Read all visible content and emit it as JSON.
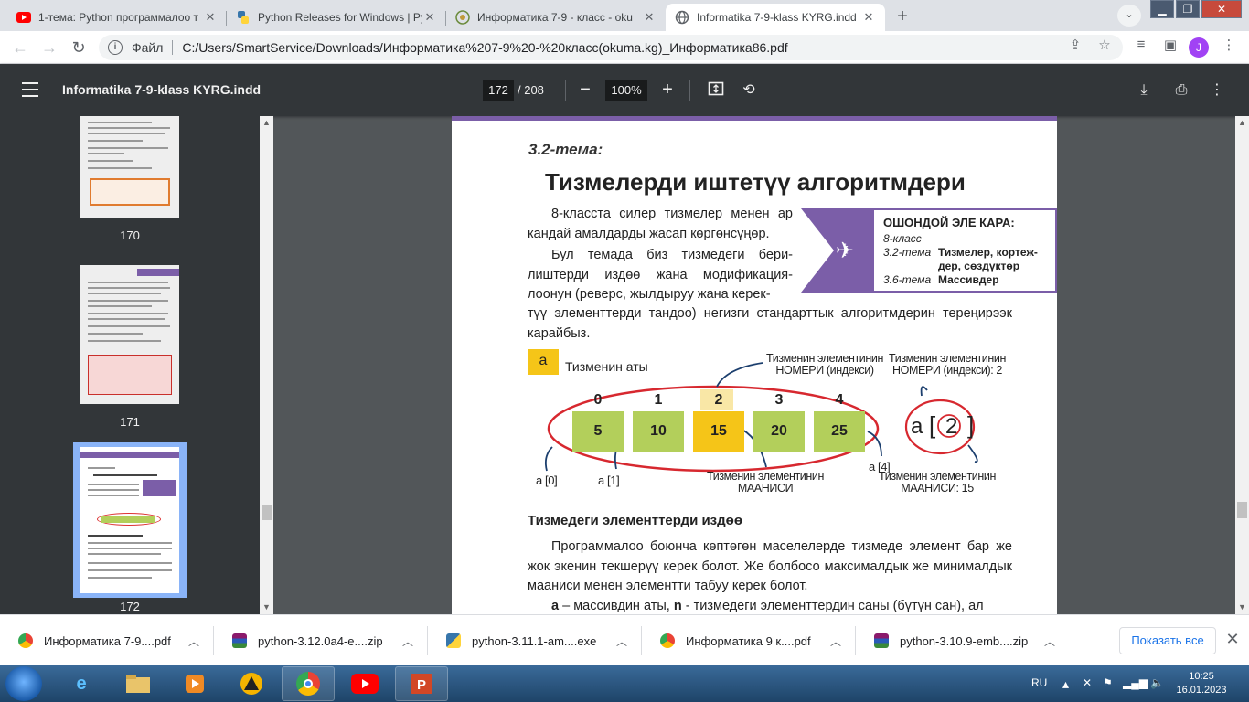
{
  "tabs": [
    {
      "title": "1-тема: Python программалоо т",
      "icon": "youtube-icon",
      "color": "#ff0000"
    },
    {
      "title": "Python Releases for Windows | Py",
      "icon": "python-icon",
      "color": "#3776ab"
    },
    {
      "title": "Информатика 7-9 - класс - oku",
      "icon": "site-icon",
      "color": "#6a8a3a"
    },
    {
      "title": "Informatika 7-9-klass KYRG.indd",
      "icon": "globe-icon",
      "color": "#5f6368"
    }
  ],
  "address": {
    "scheme": "Файл",
    "url": "C:/Users/SmartService/Downloads/Информатика%207-9%20-%20класс(okuma.kg)_Информатика86.pdf"
  },
  "profile_initial": "J",
  "pdf": {
    "title": "Informatika 7-9-klass KYRG.indd",
    "current_page": "172",
    "total_pages": "/ 208",
    "zoom": "100%"
  },
  "thumbnails": [
    {
      "num": "170"
    },
    {
      "num": "171"
    },
    {
      "num": "172"
    }
  ],
  "page": {
    "topic": "3.2-тема:",
    "title": "Тизмелерди иштетүү алгоритмдери",
    "para1": "8-класста силер тизмелер менен ар кандай амалдарды жасап көргөнсүңөр.",
    "para2": "Бул темада биз тизмедеги бериллиштерди издөө жана модификациялоонун (реверс, жылдыруу жана керектүү элементтерди тандоо) негизги стандарттык алгоритмдерин тереңирээк карайбыз.",
    "sidebox": {
      "title": "ОШОНДОЙ ЭЛЕ КАРА:",
      "grade": "8-класс",
      "rows": [
        {
          "topic": "3.2-тема",
          "text": "Тизмелер, кортеж-дер, сөздүктөр"
        },
        {
          "topic": "3.6-тема",
          "text": "Массивдер"
        }
      ]
    },
    "diagram": {
      "name_box": "a",
      "name_label": "Тизменин аты",
      "indices": [
        "0",
        "1",
        "2",
        "3",
        "4"
      ],
      "values": [
        "5",
        "10",
        "15",
        "20",
        "25"
      ],
      "ref_a0": "a [0]",
      "ref_a1": "a [1]",
      "ref_a4": "a [4]",
      "index_label_1": "Тизменин элементинин НОМЕРИ (индекси)",
      "index_label_2": "Тизменин элементинин НОМЕРИ (индекси): 2",
      "value_label_1": "Тизменин элементинин МААНИСИ",
      "value_label_2": "Тизменин элементинин МААНИСИ: 15",
      "access_name": "a",
      "access_index": "2"
    },
    "section_title": "Тизмедеги элементтерди издөө",
    "para3": "Программалоо боюнча көптөгөн маселелерде тизмеде элемент бар же жок экенин текшерүү керек болот. Же болбосо максималдык же минималдык мааниси менен элементти табуу керек болот.",
    "para4_bold_a": "a",
    "para4_a": " – массивдин аты, ",
    "para4_bold_n": "n",
    "para4_n": " -  тизмедеги элементтердин саны (бүтүн сан), ал"
  },
  "downloads": [
    {
      "name": "Информатика 7-9....pdf",
      "icon": "chrome-icon"
    },
    {
      "name": "python-3.12.0a4-e....zip",
      "icon": "winrar-icon"
    },
    {
      "name": "python-3.11.1-am....exe",
      "icon": "python-installer-icon"
    },
    {
      "name": "Информатика 9 к....pdf",
      "icon": "chrome-icon"
    },
    {
      "name": "python-3.10.9-emb....zip",
      "icon": "winrar-icon"
    }
  ],
  "show_all": "Показать все",
  "taskbar": {
    "lang": "RU",
    "time": "10:25",
    "date": "16.01.2023"
  }
}
